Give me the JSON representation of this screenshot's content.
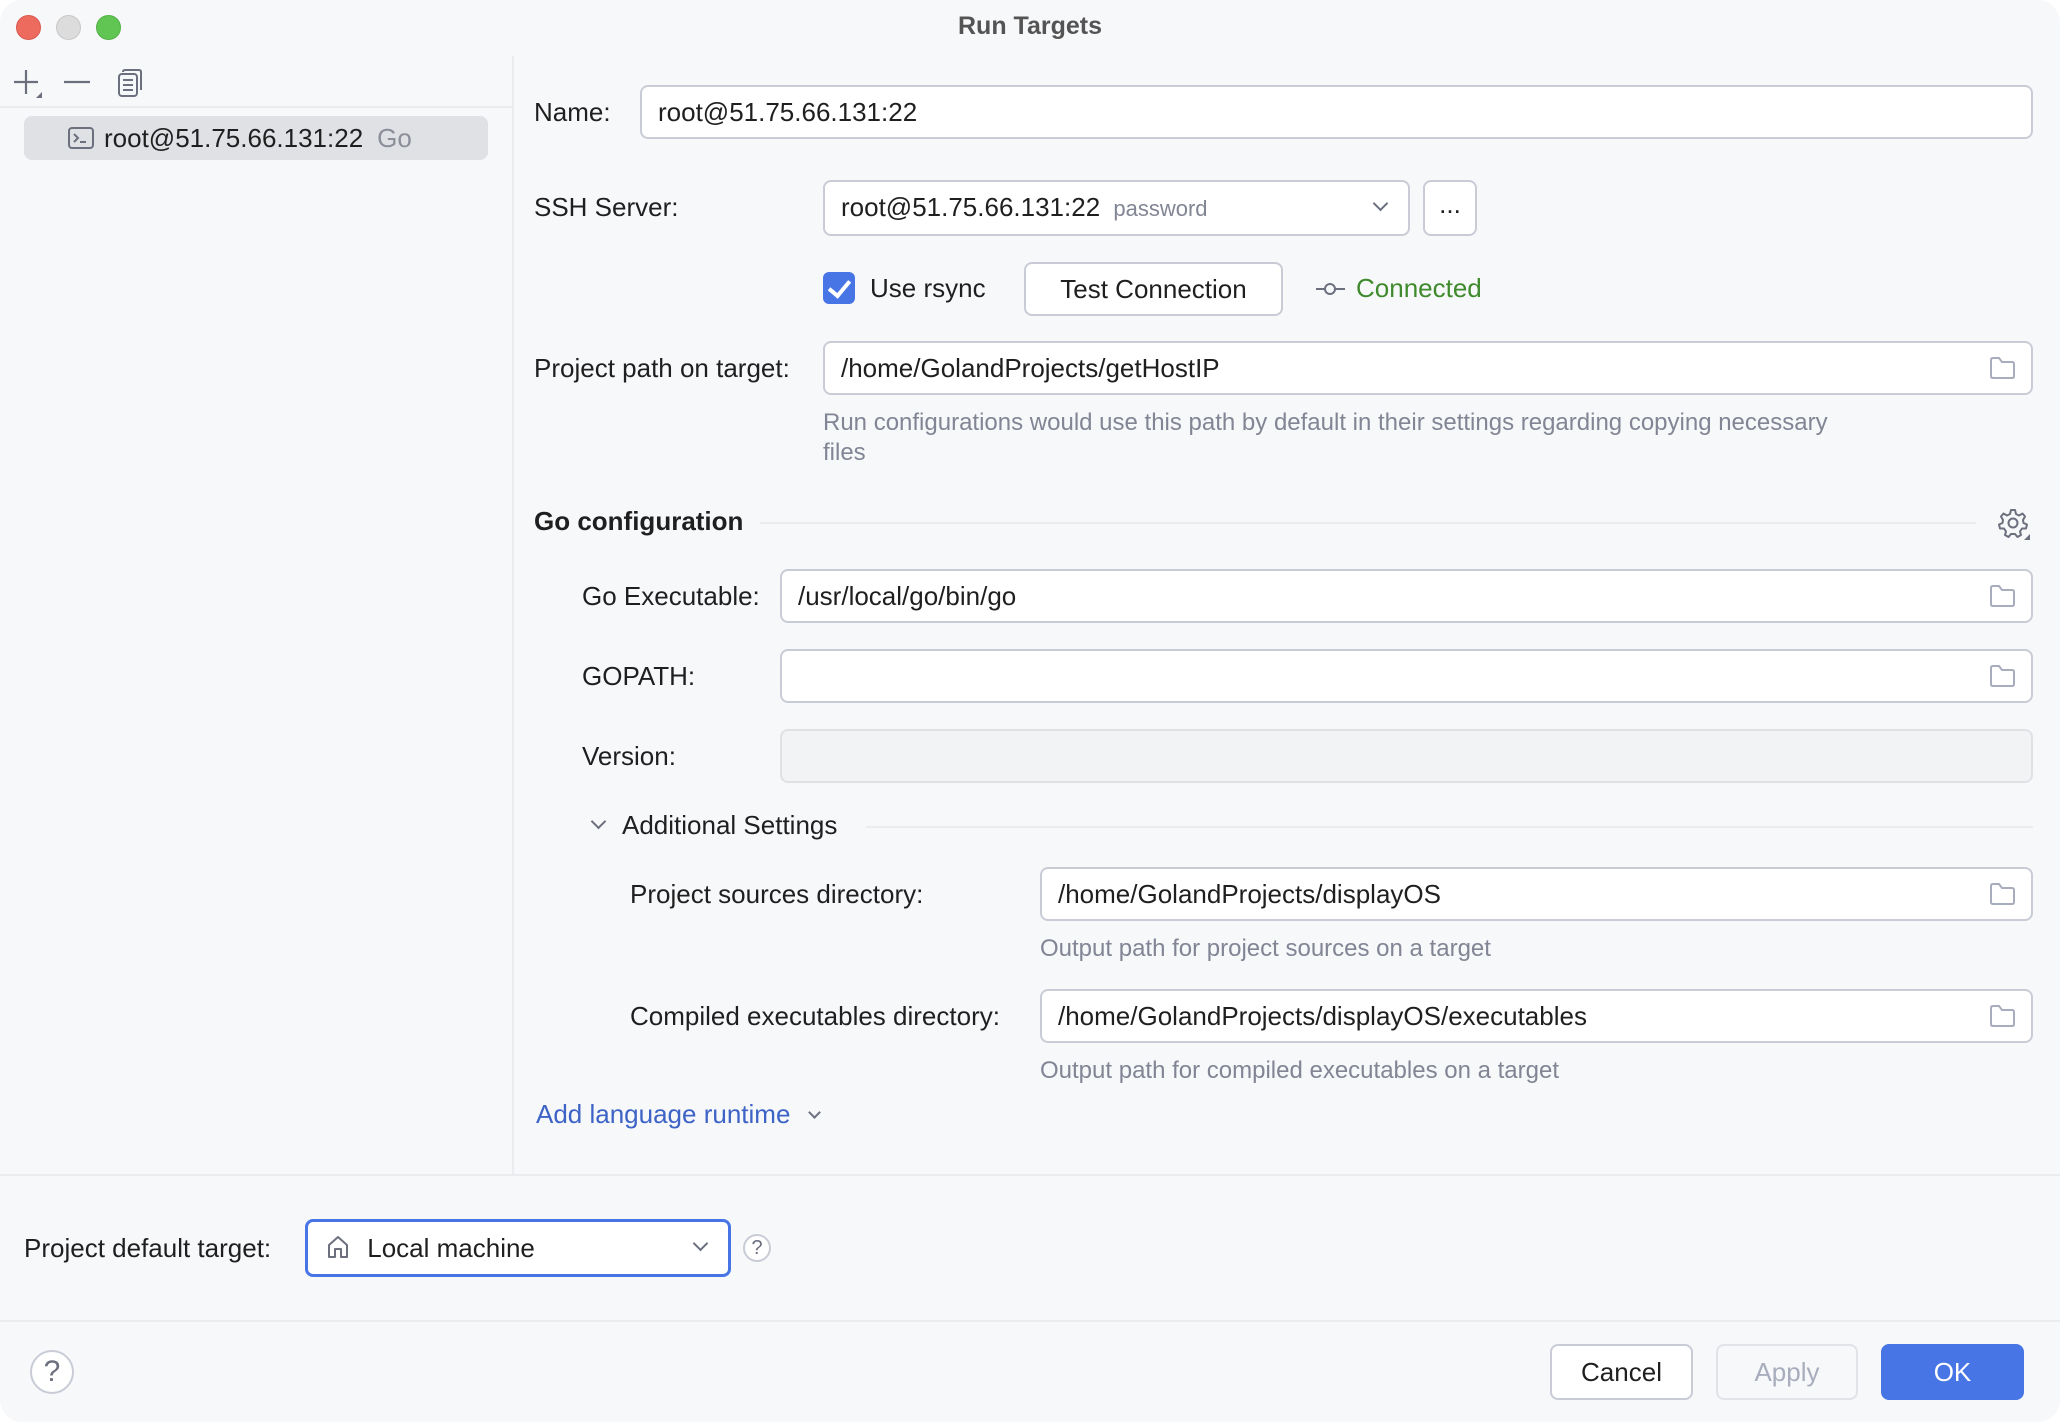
{
  "window": {
    "title": "Run Targets"
  },
  "sidebar": {
    "toolbar": {
      "add_icon": "plus-icon",
      "remove_icon": "minus-icon",
      "copy_icon": "copy-icon"
    },
    "items": [
      {
        "label": "root@51.75.66.131:22",
        "sub": "Go",
        "icon": "terminal-icon",
        "selected": true
      }
    ]
  },
  "form": {
    "name": {
      "label": "Name:",
      "value": "root@51.75.66.131:22"
    },
    "ssh_server": {
      "label": "SSH Server:",
      "value": "root@51.75.66.131:22",
      "auth": "password",
      "browse_label": "..."
    },
    "use_rsync": {
      "label": "Use rsync",
      "checked": true
    },
    "test_connection_label": "Test Connection",
    "connection_status": {
      "label": "Connected",
      "color": "#3f8a2c"
    },
    "project_path": {
      "label": "Project path on target:",
      "value": "/home/GolandProjects/getHostIP",
      "hint_line1": "Run configurations would use this path by default in their settings regarding copying necessary",
      "hint_line2": "files"
    },
    "go_config": {
      "title": "Go configuration",
      "go_executable": {
        "label": "Go Executable:",
        "value": "/usr/local/go/bin/go"
      },
      "gopath": {
        "label": "GOPATH:",
        "value": ""
      },
      "version": {
        "label": "Version:",
        "value": ""
      },
      "additional_settings": {
        "title": "Additional Settings",
        "expanded": true,
        "project_sources": {
          "label": "Project sources directory:",
          "value": "/home/GolandProjects/displayOS",
          "hint": "Output path for project sources on a target"
        },
        "compiled_executables": {
          "label": "Compiled executables directory:",
          "value": "/home/GolandProjects/displayOS/executables",
          "hint": "Output path for compiled executables on a target"
        }
      }
    },
    "add_language_runtime_label": "Add language runtime"
  },
  "default_target": {
    "label": "Project default target:",
    "value": "Local machine",
    "icon": "home-icon"
  },
  "footer": {
    "help_label": "?",
    "cancel_label": "Cancel",
    "apply_label": "Apply",
    "ok_label": "OK"
  },
  "colors": {
    "accent": "#4775e5",
    "link": "#3c63c5",
    "success": "#3f8a2c"
  }
}
